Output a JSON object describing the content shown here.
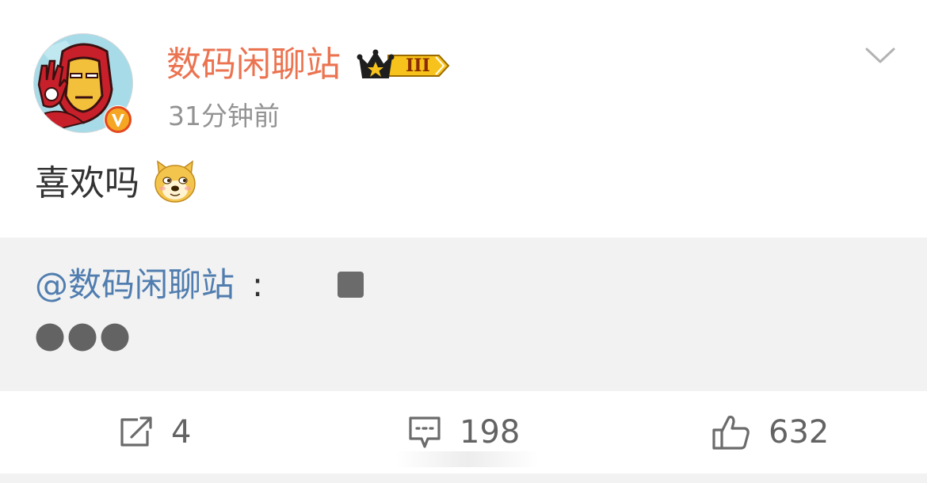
{
  "post": {
    "author": {
      "name": "数码闲聊站",
      "avatar_icon": "iron-man-avatar",
      "verified_icon": "verified-v-badge",
      "level_badge_icon": "crown-level-badge",
      "level_label": "III"
    },
    "timestamp": "31分钟前",
    "more_icon": "chevron-down-icon",
    "text": "喜欢吗",
    "emoji_icon": "doge-emoji",
    "repost": {
      "mention": "@数码闲聊站",
      "colon": ":",
      "background": "#f2f2f2"
    }
  },
  "actions": {
    "share": {
      "icon": "share-icon",
      "count": "4"
    },
    "comment": {
      "icon": "comment-icon",
      "count": "198"
    },
    "like": {
      "icon": "thumbs-up-icon",
      "count": "632"
    }
  },
  "colors": {
    "author_name": "#eb7350",
    "mention": "#507daf",
    "timestamp": "#939393",
    "count": "#636363"
  }
}
